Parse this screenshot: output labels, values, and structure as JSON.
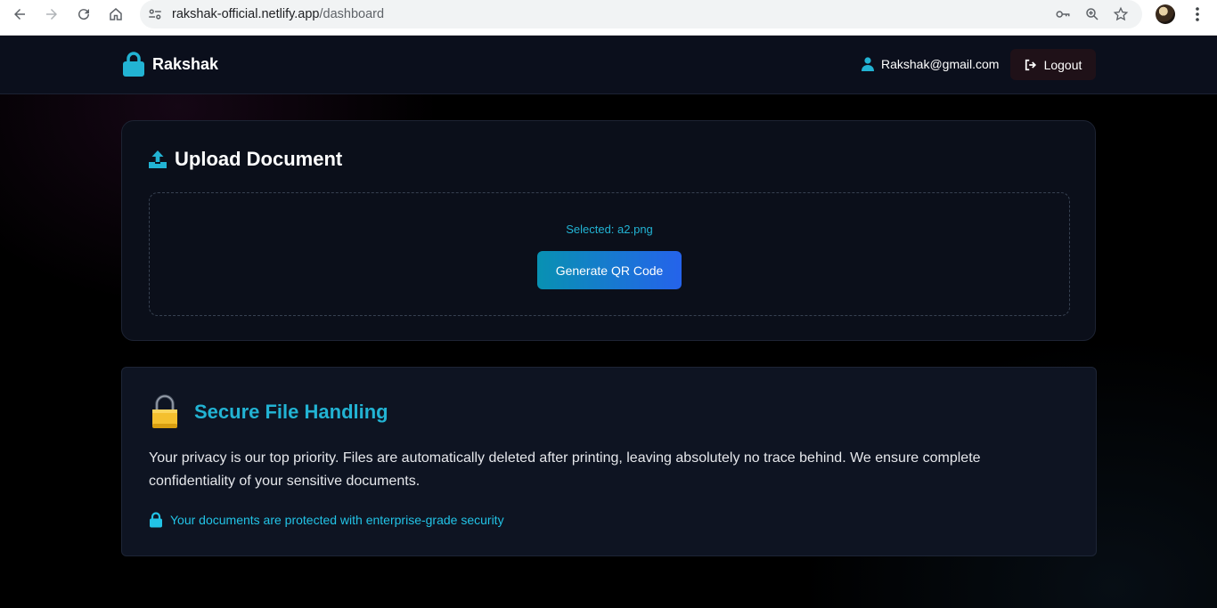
{
  "browser": {
    "url_domain": "rakshak-official.netlify.app",
    "url_path": "/dashboard",
    "icons": [
      "back-arrow-icon",
      "forward-arrow-icon",
      "reload-icon",
      "home-icon",
      "site-info-icon",
      "key-icon",
      "zoom-icon",
      "star-icon",
      "kebab-menu-icon"
    ]
  },
  "header": {
    "brand_name": "Rakshak",
    "user_email": "Rakshak@gmail.com",
    "logout_label": "Logout"
  },
  "upload": {
    "title": "Upload Document",
    "selected_text": "Selected: a2.png",
    "generate_label": "Generate QR Code"
  },
  "secure": {
    "title": "Secure File Handling",
    "description": "Your privacy is our top priority. Files are automatically deleted after printing, leaving absolutely no trace behind. We ensure complete confidentiality of your sensitive documents.",
    "note": "Your documents are protected with enterprise-grade security"
  },
  "colors": {
    "accent_cyan": "#22b3d3",
    "button_gradient_start": "#0891b2",
    "button_gradient_end": "#2563eb",
    "padlock_gold": "#f4c02e"
  }
}
